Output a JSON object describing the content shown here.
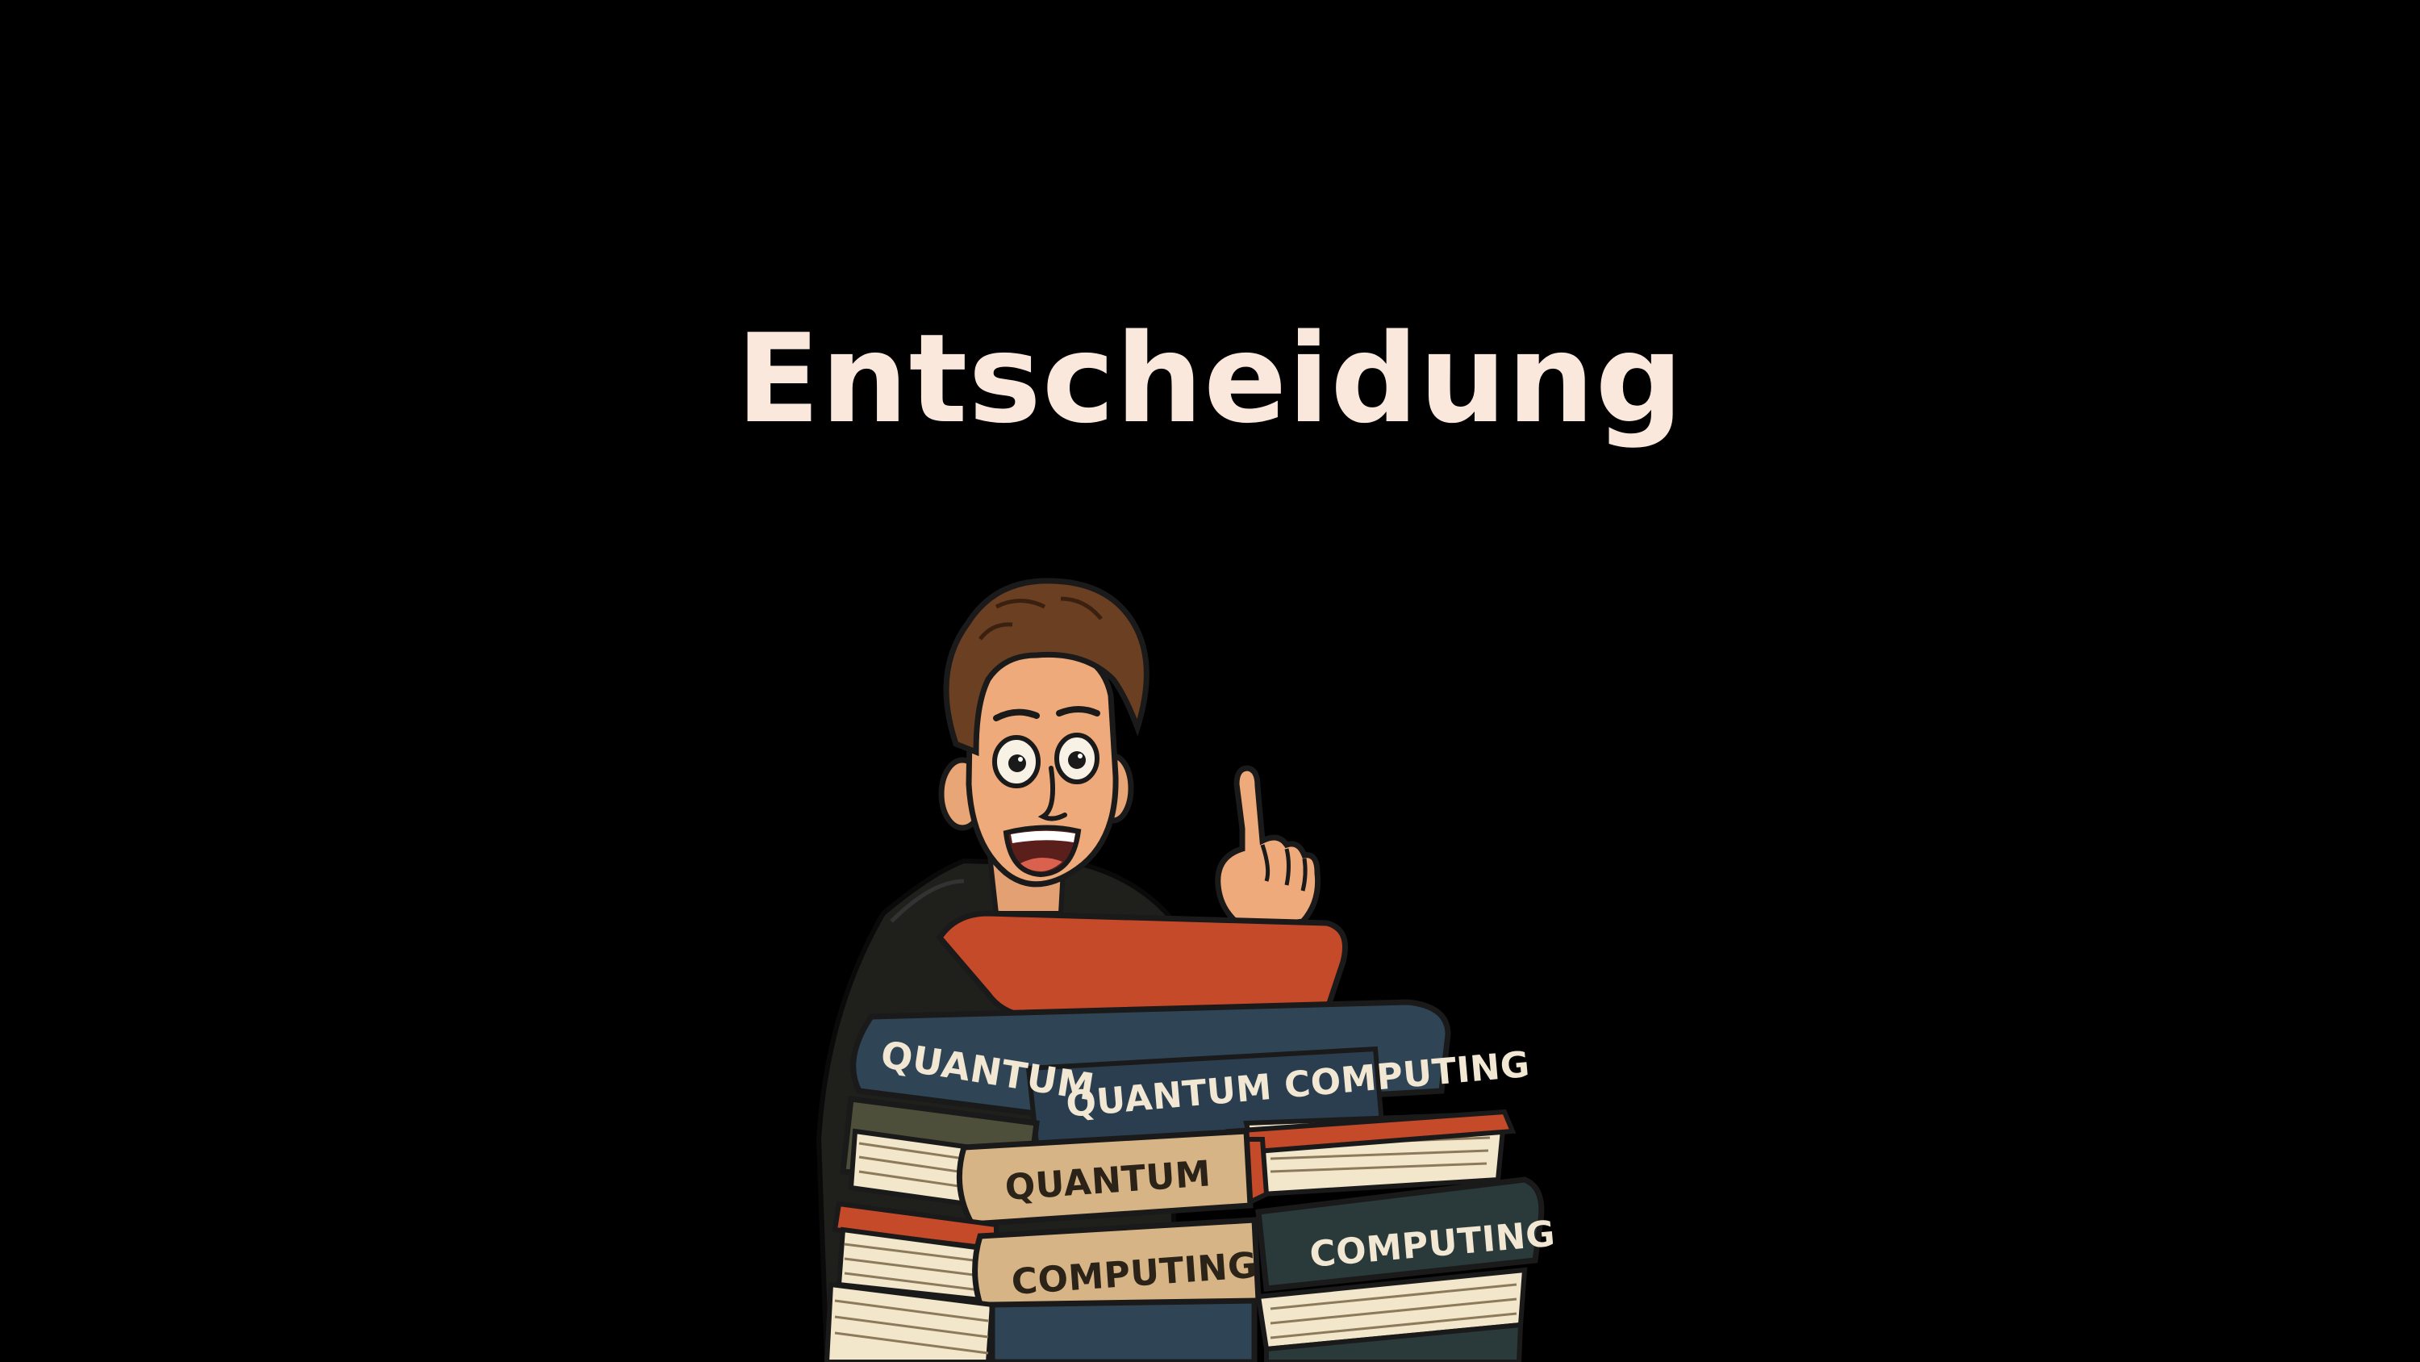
{
  "slide": {
    "title": "Entscheidung",
    "background_color": "#000000",
    "title_color": "#fbe8dd"
  },
  "illustration": {
    "subject": "cartoon man pointing up behind a stack of books",
    "book_spines": {
      "book_1": "QUANTUM",
      "book_2": "QUANTUM COMPUTING",
      "book_3": "QUANTUM",
      "book_4": "COMPUTING",
      "book_5": "COMPUTING"
    }
  }
}
